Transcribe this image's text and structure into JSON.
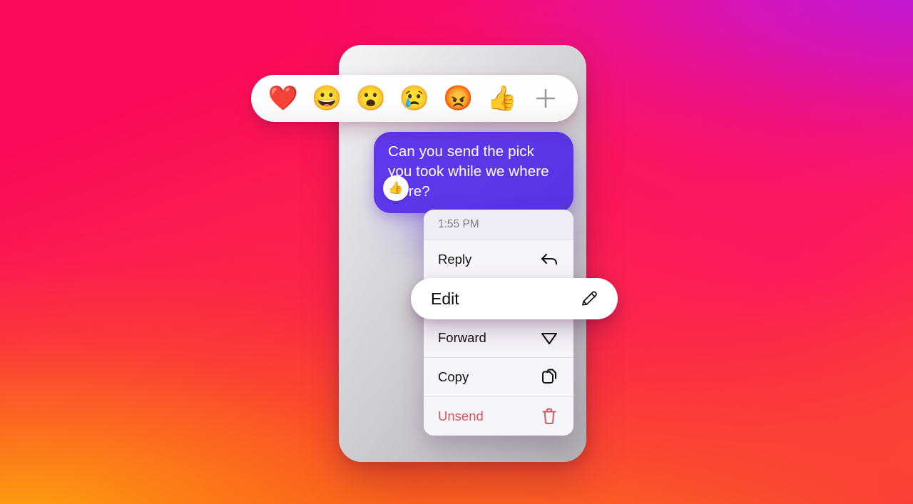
{
  "background": {
    "colors": {
      "top_left_pink": "#FA0A5A",
      "top_right_magenta": "#C31AD6",
      "bottom_left_orange": "#FB9A10",
      "bottom_right_red": "#F92A3F"
    }
  },
  "reaction_bar": {
    "name": "quick-reactions",
    "emojis": [
      {
        "name": "heart",
        "glyph": "❤️"
      },
      {
        "name": "grinning-face",
        "glyph": "😀"
      },
      {
        "name": "surprised-face",
        "glyph": "😮"
      },
      {
        "name": "crying-face",
        "glyph": "😢"
      },
      {
        "name": "angry-face",
        "glyph": "😡"
      },
      {
        "name": "thumbs-up",
        "glyph": "👍"
      }
    ],
    "more_label": "+"
  },
  "message": {
    "text": "Can you send the pick you took while we where there?",
    "bubble_color": "#5B37E8",
    "reaction": {
      "name": "thumbs-up",
      "glyph": "👍"
    }
  },
  "context_menu": {
    "timestamp": "1:55 PM",
    "items": [
      {
        "label": "Reply",
        "icon": "reply-arrow-icon",
        "danger": false
      },
      {
        "label": "Edit",
        "icon": "pencil-icon",
        "danger": false,
        "highlighted": true
      },
      {
        "label": "Forward",
        "icon": "paper-plane-icon",
        "danger": false
      },
      {
        "label": "Copy",
        "icon": "copy-pages-icon",
        "danger": false
      },
      {
        "label": "Unsend",
        "icon": "trash-icon",
        "danger": true
      }
    ],
    "danger_color": "#D9555E"
  }
}
